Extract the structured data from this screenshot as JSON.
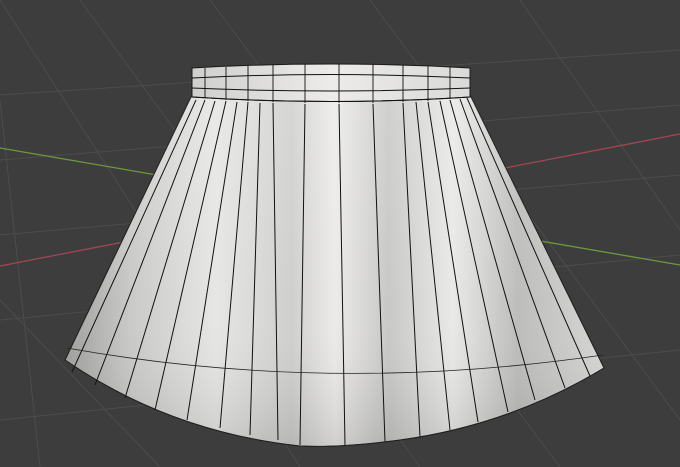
{
  "app": {
    "name": "3D viewport",
    "mode": "wireframe-overlay"
  },
  "viewport": {
    "background_color": "#3d3d3d",
    "grid_color": "#4c4c4c",
    "x_axis_color": "#a34651",
    "y_axis_color": "#6c9a3d"
  },
  "object": {
    "type": "skirt-mesh",
    "waistband_rows": 3,
    "vertical_segments": 22,
    "surface_light_color": "#e6e6e4",
    "surface_shadow_color": "#b7b7b5",
    "edge_color": "#101010"
  }
}
